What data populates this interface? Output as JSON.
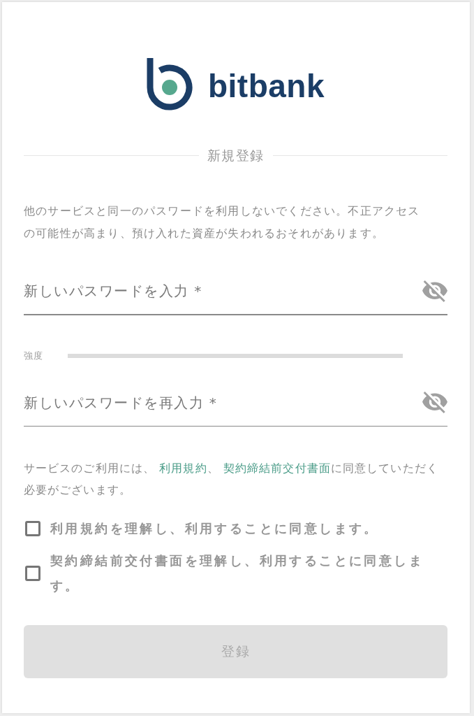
{
  "logo": {
    "wordmark": "bitbank"
  },
  "section_title": "新規登録",
  "notice": "他のサービスと同一のパスワードを利用しないでください。不正アクセスの可能性が高まり、預け入れた資産が失われるおそれがあります。",
  "password_field": {
    "placeholder": "新しいパスワードを入力 *",
    "masked": true
  },
  "strength": {
    "label": "強度"
  },
  "confirm_field": {
    "placeholder": "新しいパスワードを再入力 *",
    "masked": true
  },
  "terms_notice": {
    "parts": [
      {
        "kind": "text",
        "text": "サービスのご利用には、 "
      },
      {
        "kind": "link",
        "text": "利用規約"
      },
      {
        "kind": "text",
        "text": "、 "
      },
      {
        "kind": "link",
        "text": "契約締結前交付書面"
      },
      {
        "kind": "text",
        "text": "に同意していただく必要がございます。"
      }
    ]
  },
  "agreements": [
    {
      "label": "利用規約を理解し、利用することに同意します。",
      "checked": false
    },
    {
      "label": "契約締結前交付書面を理解し、利用することに同意します。",
      "checked": false
    }
  ],
  "submit_button": {
    "label": "登録",
    "disabled": true
  }
}
